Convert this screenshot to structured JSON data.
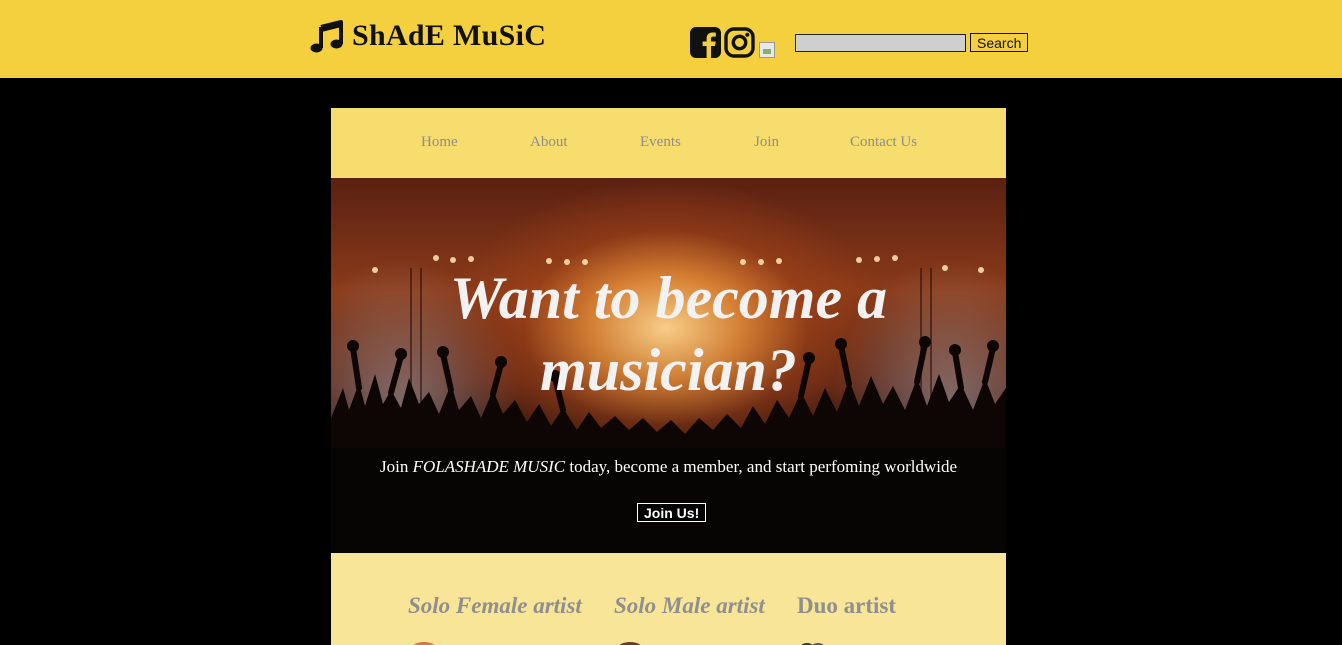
{
  "header": {
    "brand": "ShAdE MuSiC",
    "social": [
      "facebook-icon",
      "instagram-icon",
      "broken-image"
    ],
    "search": {
      "value": "",
      "button_label": "Search"
    }
  },
  "nav": {
    "items": [
      "Home",
      "About",
      "Events",
      "Join",
      "Contact Us"
    ]
  },
  "hero": {
    "headline": "Want to become a musician?",
    "tagline_prefix": "Join ",
    "tagline_brand": "FOLASHADE MUSIC",
    "tagline_suffix": " today, become a member, and start perfoming worldwide",
    "button_label": "Join Us!"
  },
  "artists": {
    "categories": [
      "Solo Female artist",
      "Solo Male artist",
      "Duo artist"
    ]
  },
  "colors": {
    "topbar": "#f4d03f",
    "nav": "#f6dd6e",
    "artists_bg": "#f8e598",
    "page_bg": "#000000"
  }
}
